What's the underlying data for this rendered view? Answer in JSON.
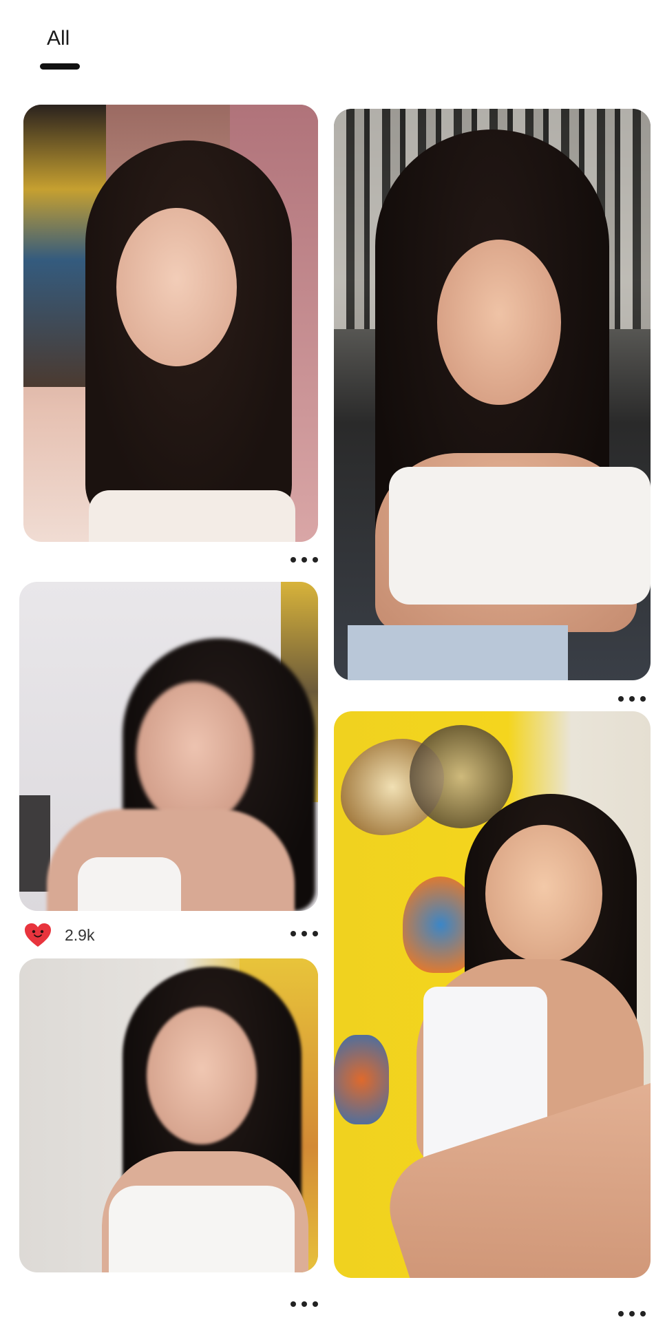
{
  "tabs": [
    {
      "label": "All",
      "active": true
    }
  ],
  "pins": [
    {
      "id": "pin-1",
      "more_icon": "more-horizontal-icon"
    },
    {
      "id": "pin-2",
      "more_icon": "more-horizontal-icon"
    },
    {
      "id": "pin-3",
      "more_icon": "more-horizontal-icon",
      "like_icon": "heart-icon",
      "likes": "2.9k"
    },
    {
      "id": "pin-4",
      "more_icon": "more-horizontal-icon"
    },
    {
      "id": "pin-5",
      "more_icon": "more-horizontal-icon"
    }
  ],
  "colors": {
    "background": "#ffffff",
    "text": "#1a1a1a",
    "heart": "#e8343d"
  }
}
